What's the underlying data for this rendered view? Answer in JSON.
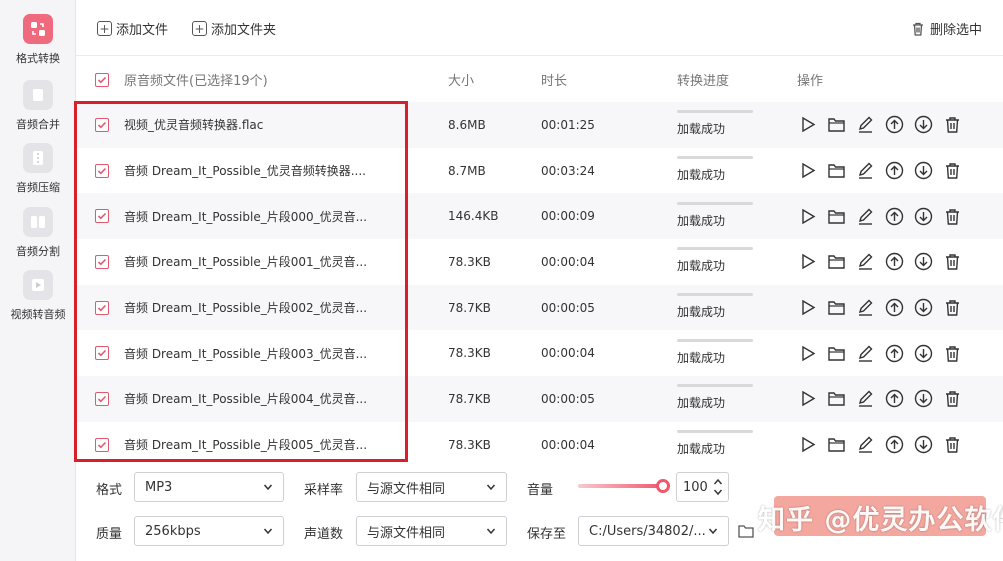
{
  "sidebar": {
    "items": [
      {
        "label": "格式转换",
        "icon": "format-convert-icon",
        "active": true
      },
      {
        "label": "音频合并",
        "icon": "merge-icon",
        "active": false
      },
      {
        "label": "音频压缩",
        "icon": "compress-icon",
        "active": false
      },
      {
        "label": "音频分割",
        "icon": "split-icon",
        "active": false
      },
      {
        "label": "视频转音频",
        "icon": "video-to-audio-icon",
        "active": false
      }
    ]
  },
  "toolbar": {
    "add_file": "添加文件",
    "add_folder": "添加文件夹",
    "delete_selected": "删除选中"
  },
  "table": {
    "header": {
      "file": "原音频文件(已选择19个)",
      "size": "大小",
      "duration": "时长",
      "progress": "转换进度",
      "actions": "操作"
    },
    "rows": [
      {
        "name": "视频_优灵音频转换器.flac",
        "size": "8.6MB",
        "duration": "00:01:25",
        "status": "加载成功"
      },
      {
        "name": "音频 Dream_It_Possible_优灵音频转换器....",
        "size": "8.7MB",
        "duration": "00:03:24",
        "status": "加载成功"
      },
      {
        "name": "音频 Dream_It_Possible_片段000_优灵音...",
        "size": "146.4KB",
        "duration": "00:00:09",
        "status": "加载成功"
      },
      {
        "name": "音频 Dream_It_Possible_片段001_优灵音...",
        "size": "78.3KB",
        "duration": "00:00:04",
        "status": "加载成功"
      },
      {
        "name": "音频 Dream_It_Possible_片段002_优灵音...",
        "size": "78.7KB",
        "duration": "00:00:05",
        "status": "加载成功"
      },
      {
        "name": "音频 Dream_It_Possible_片段003_优灵音...",
        "size": "78.3KB",
        "duration": "00:00:04",
        "status": "加载成功"
      },
      {
        "name": "音频 Dream_It_Possible_片段004_优灵音...",
        "size": "78.7KB",
        "duration": "00:00:05",
        "status": "加载成功"
      },
      {
        "name": "音频 Dream_It_Possible_片段005_优灵音...",
        "size": "78.3KB",
        "duration": "00:00:04",
        "status": "加载成功"
      }
    ]
  },
  "settings": {
    "format_label": "格式",
    "format_value": "MP3",
    "samplerate_label": "采样率",
    "samplerate_value": "与源文件相同",
    "volume_label": "音量",
    "volume_value": "100",
    "volume_level": 1.0,
    "quality_label": "质量",
    "quality_value": "256kbps",
    "channels_label": "声道数",
    "channels_value": "与源文件相同",
    "saveto_label": "保存至",
    "saveto_value": "C:/Users/34802/..."
  },
  "watermark": "知乎 @优灵办公软件",
  "colors": {
    "accent": "#f06a7e",
    "highlight_box": "#d8202a"
  }
}
